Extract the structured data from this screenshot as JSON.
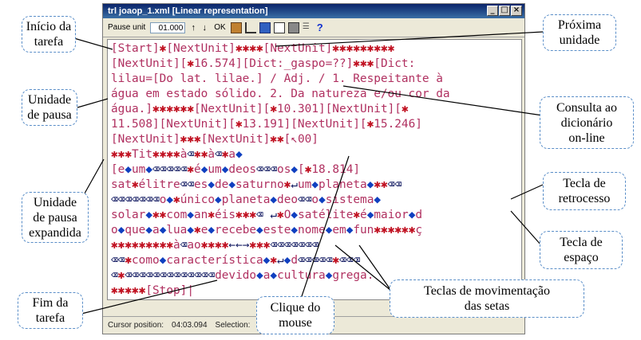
{
  "window": {
    "title": "trl joaop_1.xml [Linear representation]",
    "buttons": {
      "minimize": "_",
      "maximize": "□",
      "close": "×"
    }
  },
  "toolbar": {
    "pause_label": "Pause unit",
    "pause_value": "01.000",
    "up": "↑",
    "down": "↓",
    "ok": "OK",
    "help": "?"
  },
  "editor": {
    "lines": [
      "[Start]✱[NextUnit]✱✱✱✱[NextUnit]✱✱✱✱✱✱✱✱✱",
      "[NextUnit][✱16.574][Dict:_gaspo=??]✱✱✱[Dict:",
      "lilau=[Do lat. lilae.] / Adj. / 1. Respeitante à",
      "água em estado sólido. 2. Da natureza e/ou cor da",
      "água.]✱✱✱✱✱✱[NextUnit][✱10.301][NextUnit][✱",
      "11.508][NextUnit][✱13.191][NextUnit][✱15.246]",
      "[NextUnit]✱✱✱[NextUnit]✱✱[↖00]",
      "✱✱✱Tit✱✱✱✱à⌫✱✱à⌫✱a◆",
      "[e◆um◆⌫⌫⌫⌫⌫✱é◆um◆deos⌫⌫⌫os◆[✱18.814]",
      "sat✱élitre⌫⌫es◆de◆saturno✱↵um◆planeta◆✱✱⌫⌫",
      "⌫⌫⌫⌫⌫⌫⌫o◆✱único◆planeta◆deo⌫⌫o◆sistema◆",
      "solar◆✱✱com◆an✱éis✱✱✱⌫ ↵✱O◆satélite✱é◆maior◆d",
      "o◆que◆a◆lua◆✱e◆recebe◆este◆nome◆em◆fun✱✱✱✱✱✱ç",
      "✱✱✱✱✱✱✱✱✱à⌫ao✱✱✱✱←←→✱✱✱⌫⌫⌫⌫⌫⌫⌫",
      "⌫⌫✱como◆característica◆✱↵◆d⌫⌫⌫⌫⌫✱⌫⌫⌫",
      "⌫✱⌫⌫⌫⌫⌫⌫⌫⌫⌫⌫⌫⌫⌫devido◆a◆cultura◆grega.",
      "✱✱✱✱✱[Stop]|"
    ]
  },
  "statusbar": {
    "cursor_label": "Cursor position:",
    "cursor_value": "04:03.094",
    "selection_label": "Selection:",
    "selection_value": "-"
  },
  "callouts": {
    "inicio": "Início da\ntarefa",
    "pausa": "Unidade\nde pausa",
    "pausa_exp": "Unidade\nde pausa\nexpandida",
    "fim": "Fim da\ntarefa",
    "proxima": "Próxima\nunidade",
    "consulta": "Consulta ao\ndicionário\non-line",
    "retrocesso": "Tecla de\nretrocesso",
    "espaco": "Tecla de\nespaço",
    "clique": "Clique do\nmouse",
    "setas": "Teclas de movimentação\ndas setas"
  },
  "colors": {
    "text_purple": "#b03060",
    "star_red": "#c01020",
    "callout_border": "#5a8ec8",
    "title_blue": "#0a246a"
  }
}
